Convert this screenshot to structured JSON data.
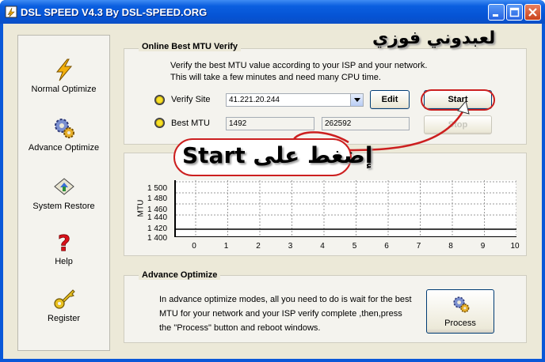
{
  "window": {
    "title": "DSL SPEED V4.3 By DSL-SPEED.ORG"
  },
  "sidebar": {
    "items": [
      {
        "label": "Normal Optimize",
        "icon": "lightning-icon"
      },
      {
        "label": "Advance Optimize",
        "icon": "gears-icon"
      },
      {
        "label": "System Restore",
        "icon": "restore-icon"
      },
      {
        "label": "Help",
        "icon": "help-icon"
      },
      {
        "label": "Register",
        "icon": "key-icon"
      }
    ]
  },
  "mtu_verify": {
    "title": "Online Best MTU Verify",
    "description_line1": "Verify the best MTU value according to your ISP and your network.",
    "description_line2": "This will take a few minutes and need many CPU time.",
    "verify_site_label": "Verify Site",
    "verify_site_value": "41.221.20.244",
    "edit_button": "Edit",
    "start_button": "Start",
    "best_mtu_label": "Best MTU",
    "best_mtu_value1": "1492",
    "best_mtu_value2": "262592",
    "stop_button": "Stop"
  },
  "graph": {
    "ylabel": "MTU",
    "yticks": [
      "1 500",
      "1 480",
      "1 460",
      "1 440",
      "1 420",
      "1 400"
    ],
    "xticks": [
      "0",
      "1",
      "2",
      "3",
      "4",
      "5",
      "6",
      "7",
      "8",
      "9",
      "10"
    ]
  },
  "advance_optimize": {
    "title": "Advance Optimize",
    "text_line1": "In advance optimize modes, all you need to do is wait for the best",
    "text_line2": "MTU for your network and your ISP verify complete ,then,press",
    "text_line3": "the \"Process\" button and reboot windows.",
    "process_button": "Process"
  },
  "annotations": {
    "author_name": "لعبدوني فوزي",
    "instruction": "إضغط على Start"
  },
  "colors": {
    "titlebar": "#0553d4",
    "annotation_red": "#cc1f1f",
    "radio_yellow": "#f7e12b"
  }
}
